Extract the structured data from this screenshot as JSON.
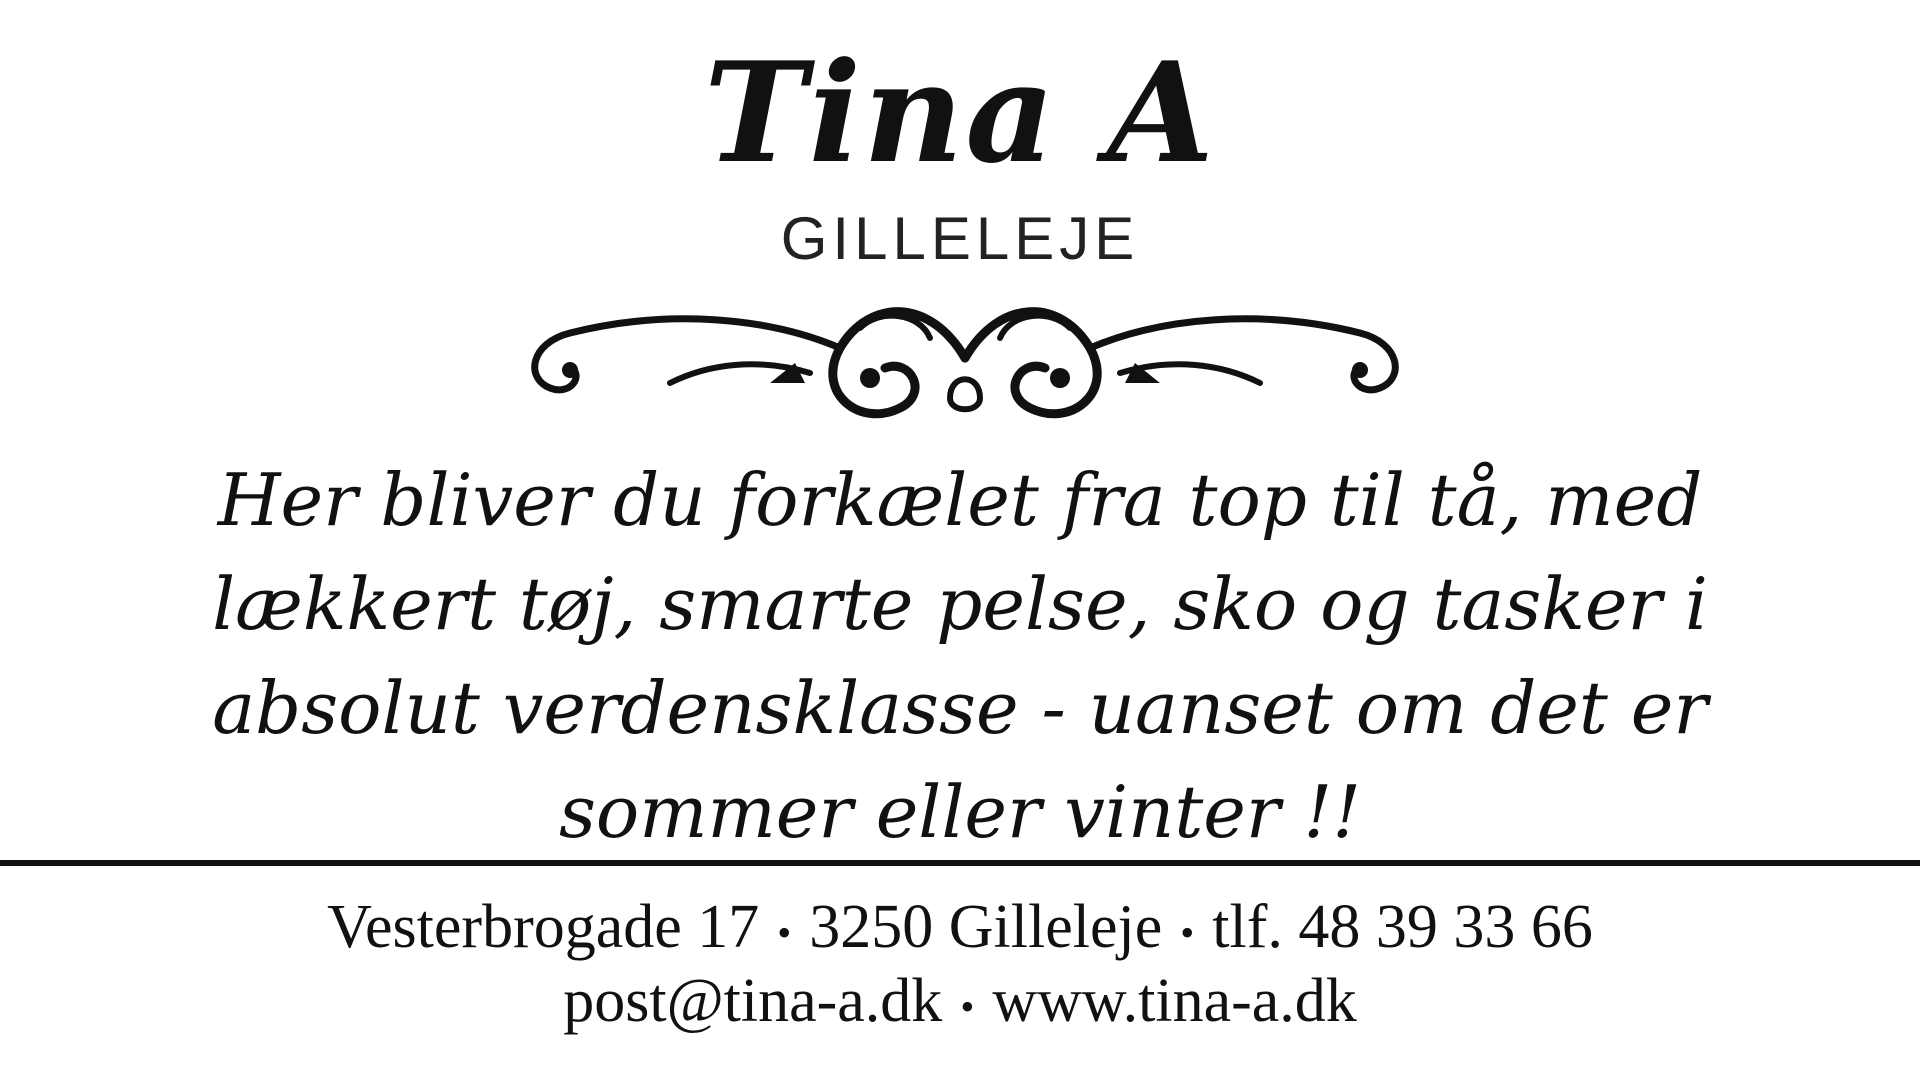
{
  "logo": {
    "title": "Tina A",
    "subtitle": "GILLELEJE",
    "ornament_icon": "flourish-scroll-icon"
  },
  "slogan": {
    "lines": [
      "Her bliver du forkælet fra top til tå, med",
      "lækkert tøj, smarte pelse, sko og tasker i",
      "absolut verdensklasse - uanset om det er",
      "sommer eller vinter !!"
    ]
  },
  "contact": {
    "address": "Vesterbrogade 17",
    "postal": "3250 Gilleleje",
    "phone": "tlf. 48 39 33 66",
    "email": "post@tina-a.dk",
    "website": "www.tina-a.dk",
    "separator": "•"
  },
  "colors": {
    "background": "#ffffff",
    "ink": "#111111"
  }
}
